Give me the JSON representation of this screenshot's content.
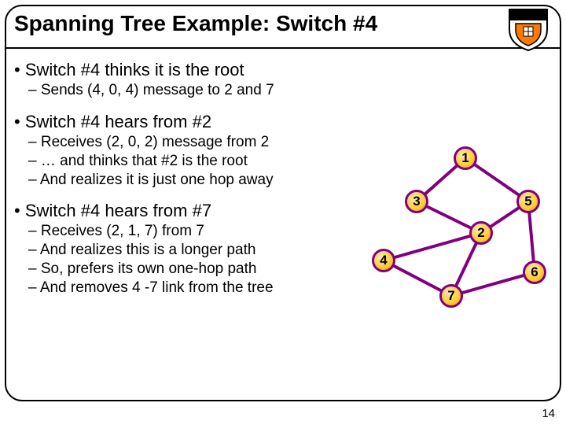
{
  "slide": {
    "title": "Spanning Tree Example: Switch #4",
    "page_number": "14"
  },
  "bullets": {
    "p1": {
      "head": "Switch #4 thinks it is the root",
      "s1": "Sends (4, 0, 4) message to 2 and 7"
    },
    "p2": {
      "head": "Switch #4 hears from #2",
      "s1": "Receives (2, 0, 2) message from 2",
      "s2": "… and thinks that #2 is the root",
      "s3": "And realizes it is just one hop away"
    },
    "p3": {
      "head": "Switch #4 hears from #7",
      "s1": "Receives (2, 1, 7) from 7",
      "s2": "And realizes this is a longer path",
      "s3": "So, prefers its own one-hop path",
      "s4": "And removes 4 -7 link from the tree"
    }
  },
  "graph": {
    "node_color_fill": "#ffcc33",
    "node_color_border": "#800080",
    "edge_color": "#800080",
    "nodes": {
      "n1": "1",
      "n2": "2",
      "n3": "3",
      "n4": "4",
      "n5": "5",
      "n6": "6",
      "n7": "7"
    }
  }
}
